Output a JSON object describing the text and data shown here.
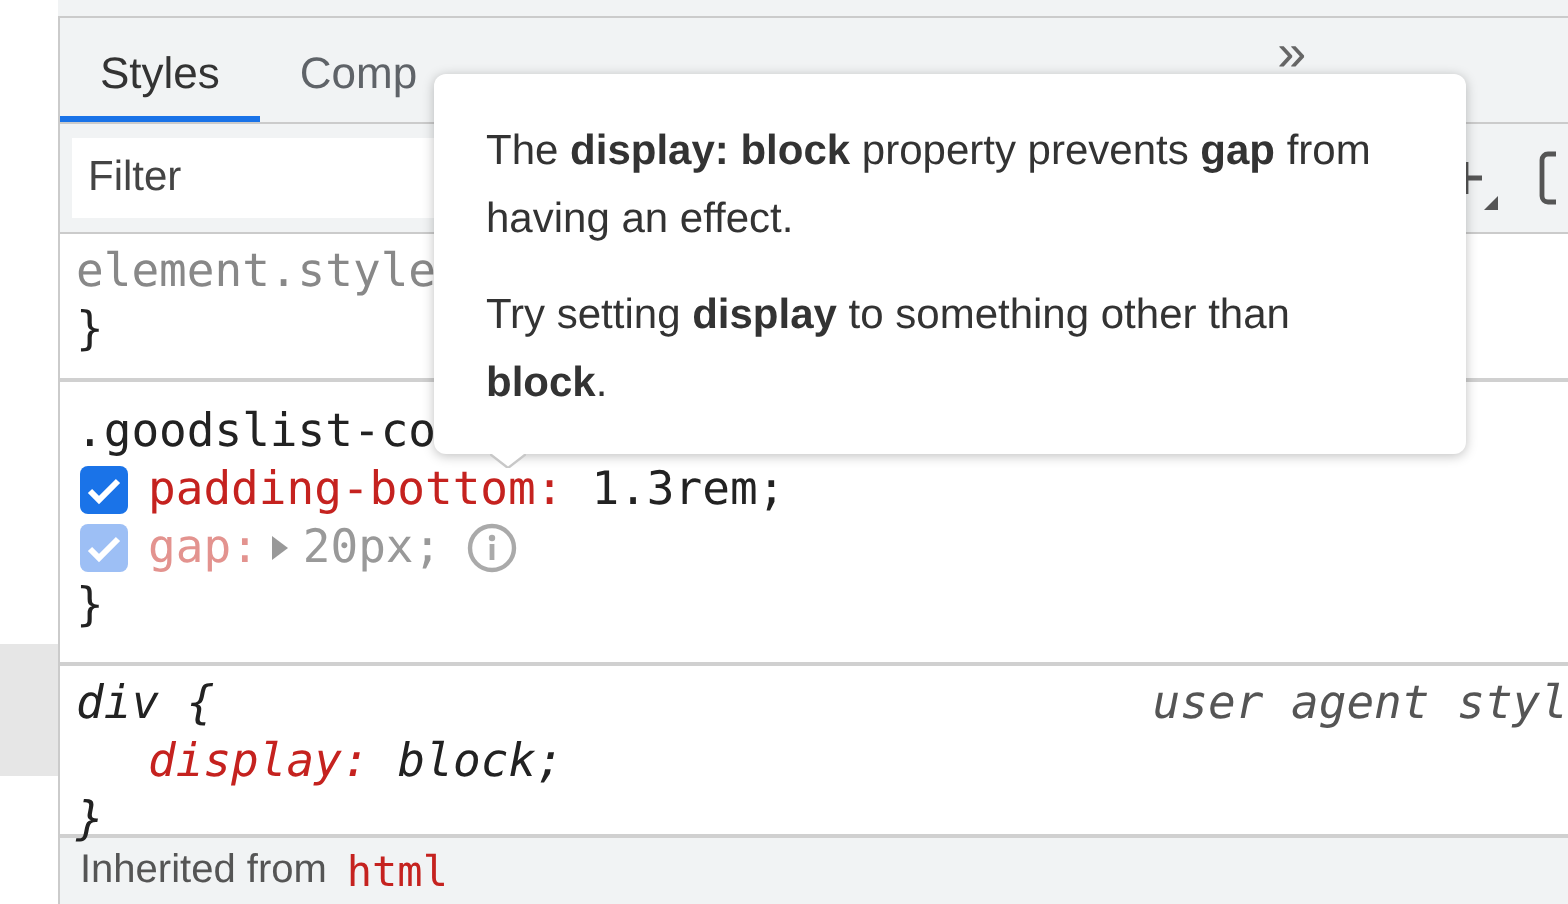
{
  "tabs": [
    {
      "label": "Styles",
      "selected": true
    },
    {
      "label": "Comp",
      "selected": false
    }
  ],
  "more_tabs": "»",
  "filter": {
    "placeholder": "Filter"
  },
  "rules": [
    {
      "kind": "inline",
      "selector": "element.style",
      "close": "}"
    },
    {
      "kind": "author",
      "selector": ".goodslist-co",
      "close": "}",
      "declarations": [
        {
          "property": "padding-bottom:",
          "value": "1.3rem;",
          "checked": true,
          "inactive": false
        },
        {
          "property": "gap:",
          "value": "20px;",
          "checked": true,
          "inactive": true,
          "expandable": true
        }
      ]
    },
    {
      "kind": "user-agent",
      "selector": "div {",
      "source": "user agent styl",
      "close": "}",
      "declarations": [
        {
          "property": "display:",
          "value": "block;"
        }
      ]
    }
  ],
  "inherited": {
    "label": "Inherited from",
    "selector": "html"
  },
  "tooltip": {
    "paragraphs": [
      "The **display: block** property prevents **gap** from having an effect.",
      "Try setting **display** to something other than **block**."
    ]
  }
}
